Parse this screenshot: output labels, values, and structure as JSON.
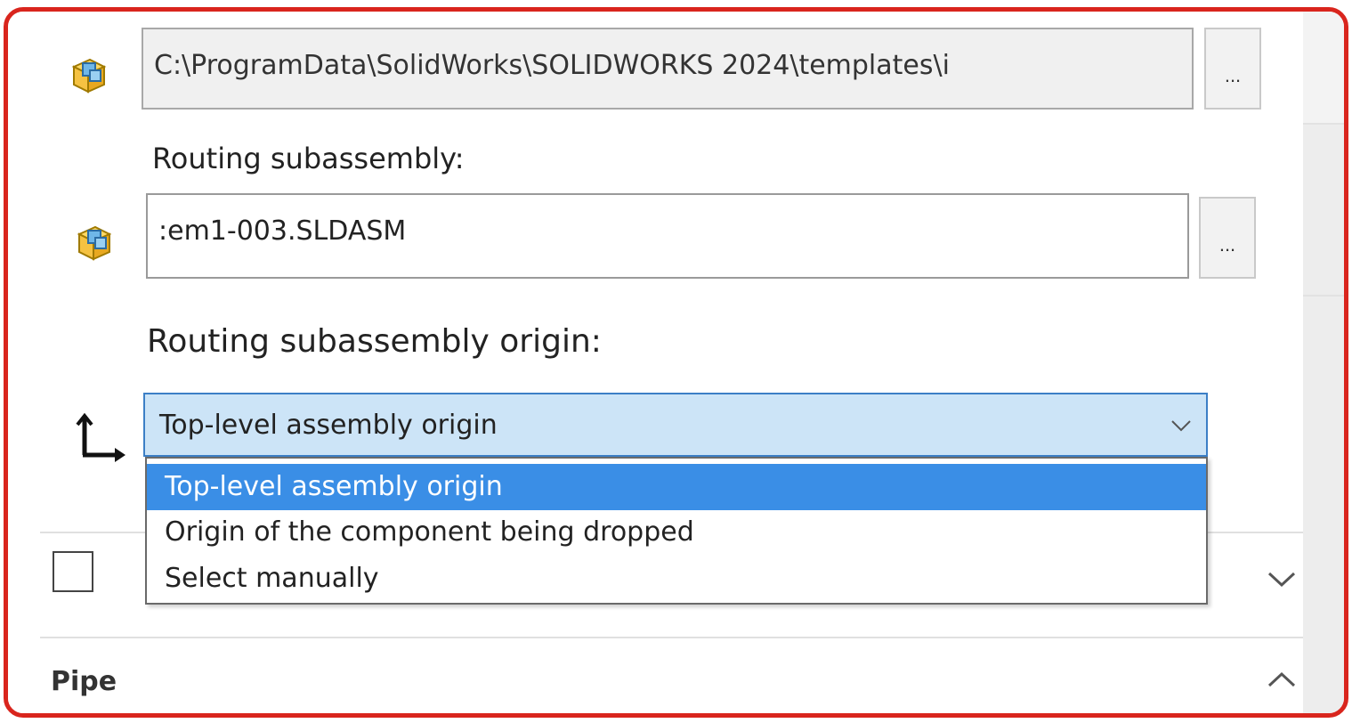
{
  "template_field": {
    "value": "C:\\ProgramData\\SolidWorks\\SOLIDWORKS 2024\\templates\\i",
    "browse_label": "..."
  },
  "routing_subassembly": {
    "label": "Routing subassembly:",
    "value": ":em1-003.SLDASM",
    "browse_label": "..."
  },
  "routing_origin": {
    "label": "Routing subassembly origin:",
    "selected": "Top-level assembly origin",
    "options": [
      "Top-level assembly origin",
      "Origin of the component being dropped",
      "Select manually"
    ]
  },
  "pipe_section": {
    "title": "Pipe"
  },
  "colors": {
    "highlight_border": "#d9251d",
    "combo_selected_bg": "#cce4f7",
    "option_selected_bg": "#3a8ee6"
  },
  "icons": [
    "assembly-icon",
    "axis-origin-icon",
    "chevron-down-icon",
    "chevron-up-icon"
  ]
}
